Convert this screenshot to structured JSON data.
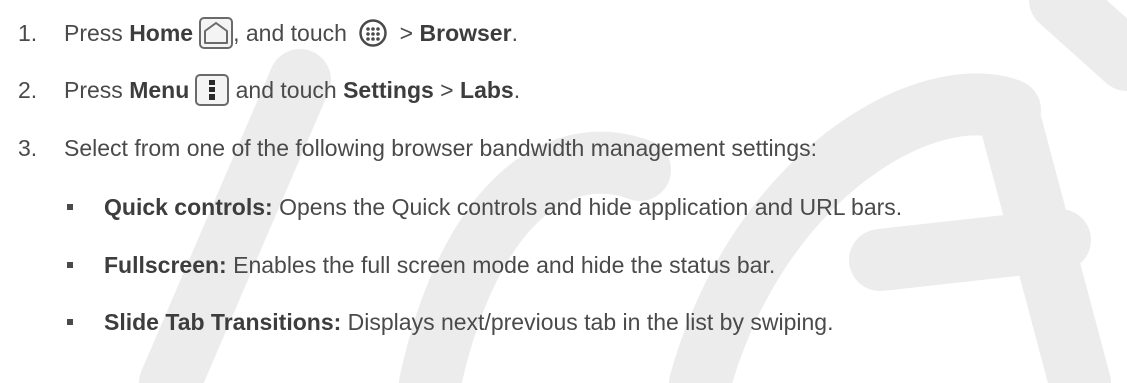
{
  "steps": [
    {
      "number": "1.",
      "parts": {
        "t1": "Press ",
        "b1": "Home",
        "t2": ", and touch ",
        "t3": " > ",
        "b2": "Browser",
        "t4": "."
      },
      "icons": [
        "home-key-icon",
        "apps-launcher-icon"
      ]
    },
    {
      "number": "2.",
      "parts": {
        "t1": "Press ",
        "b1": "Menu",
        "t2": " and touch ",
        "b2": "Settings",
        "t3": " > ",
        "b3": "Labs",
        "t4": "."
      },
      "icons": [
        "menu-key-icon"
      ]
    },
    {
      "number": "3.",
      "text": "Select from one of the following browser bandwidth management settings:"
    }
  ],
  "bullets": [
    {
      "term": "Quick controls:",
      "desc": " Opens the Quick controls and hide application and URL bars."
    },
    {
      "term": "Fullscreen:",
      "desc": " Enables the full screen mode and hide the status bar."
    },
    {
      "term": "Slide Tab Transitions:",
      "desc": " Displays next/previous tab in the list by swiping."
    }
  ],
  "colors": {
    "text": "#4a4a4a",
    "watermark": "#eeeeee"
  }
}
